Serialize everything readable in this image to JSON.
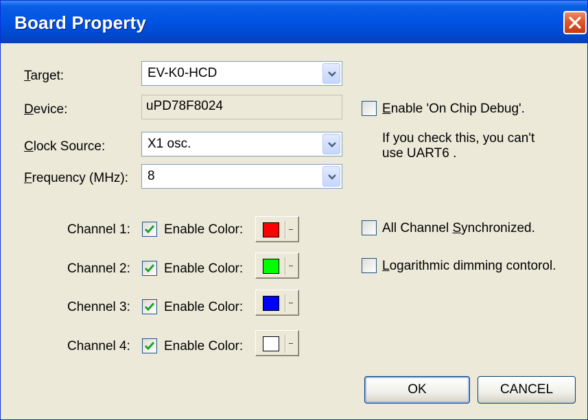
{
  "window": {
    "title": "Board Property",
    "close_label": "×"
  },
  "form": {
    "target": {
      "label_acc": "T",
      "label_rest": "arget:",
      "value": "EV-K0-HCD"
    },
    "device": {
      "label_acc": "D",
      "label_rest": "evice:",
      "value": "uPD78F8024"
    },
    "clock": {
      "label_acc": "C",
      "label_rest": "lock Source:",
      "value": "X1 osc."
    },
    "freq": {
      "label_acc": "F",
      "label_rest": "requency (MHz):",
      "value": "8"
    }
  },
  "debug": {
    "checked": false,
    "label_acc": "E",
    "label_rest": "nable 'On Chip Debug'.",
    "note_line1": "If you check this, you can't",
    "note_line2": "use UART6 ."
  },
  "channels": [
    {
      "label": "Channel 1:",
      "enable_label": "Enable Color:",
      "checked": true,
      "color": "#ff0000"
    },
    {
      "label": "Channel 2:",
      "enable_label": "Enable Color:",
      "checked": true,
      "color": "#00ff00"
    },
    {
      "label": "Chennel 3:",
      "enable_label": "Enable Color:",
      "checked": true,
      "color": "#0000ff"
    },
    {
      "label": "Channel 4:",
      "enable_label": "Enable Color:",
      "checked": true,
      "color": "#ffffff"
    }
  ],
  "options": {
    "sync": {
      "checked": false,
      "label_pre": "All Channel ",
      "label_acc": "S",
      "label_rest": "ynchronized."
    },
    "log": {
      "checked": false,
      "label_acc": "L",
      "label_rest": "ogarithmic dimming contorol."
    }
  },
  "buttons": {
    "ok": "OK",
    "cancel": "CANCEL"
  },
  "colors": {
    "title_bar": "#0054e3",
    "dialog_bg": "#ece9d8",
    "check_mark": "#21a121",
    "close_button": "#e0582b"
  }
}
